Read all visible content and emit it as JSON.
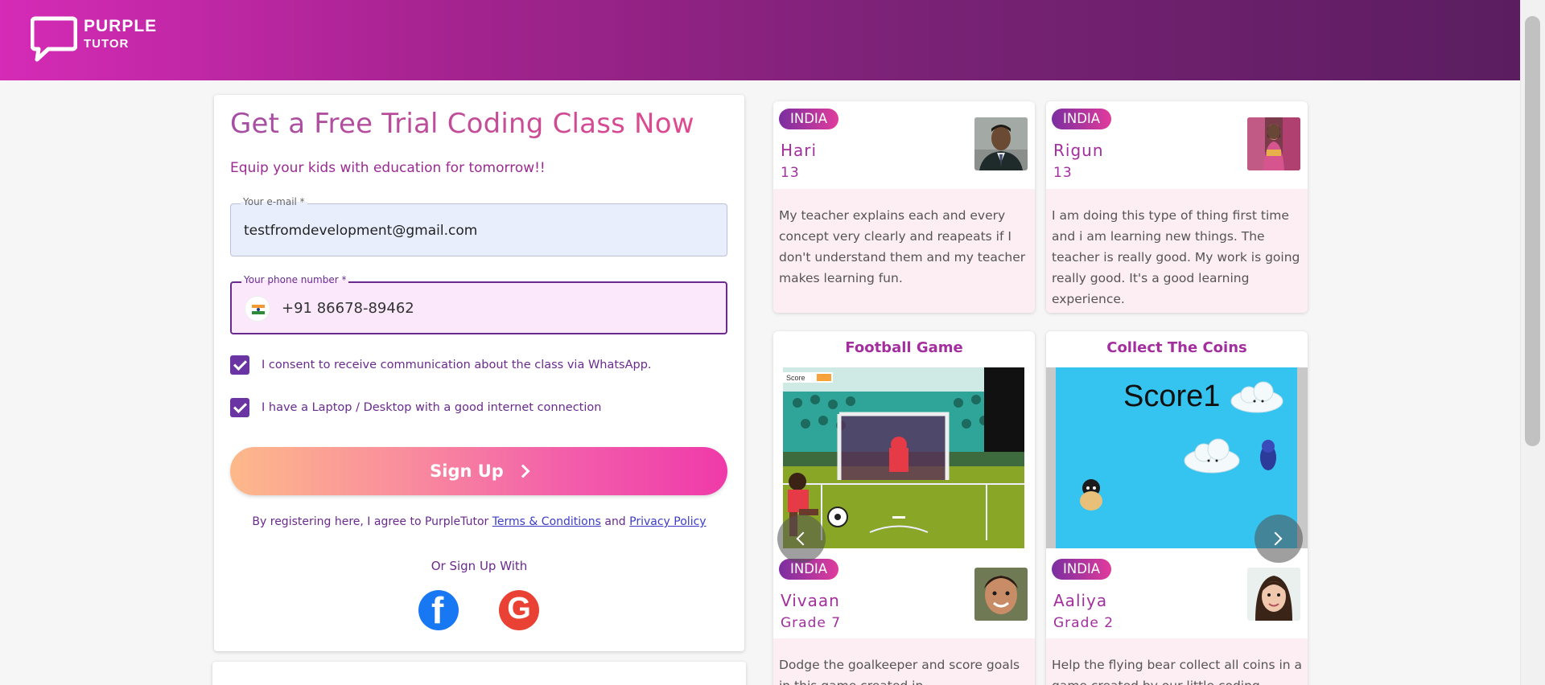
{
  "header": {
    "brand_line1": "PURPLE",
    "brand_line2": "TUTOR",
    "gradient": [
      "#d52bb6",
      "#5b1d60"
    ]
  },
  "form": {
    "title": "Get a Free Trial Coding Class Now",
    "subtitle": "Equip your kids with education for tomorrow!!",
    "email_label": "Your e-mail *",
    "email_value": "testfromdevelopment@gmail.com",
    "phone_label": "Your phone number *",
    "phone_value": "+91 86678-89462",
    "consent_whatsapp": "I consent to receive communication about the class via WhatsApp.",
    "consent_laptop": "I have a Laptop / Desktop with a good internet connection",
    "signup_label": "Sign Up",
    "terms_prefix": "By registering here, I agree to PurpleTutor",
    "terms_link": "Terms & Conditions",
    "terms_and": "and",
    "privacy_link": "Privacy Policy",
    "or_signup": "Or Sign Up With",
    "facebook_glyph": "f",
    "google_glyph": "G"
  },
  "testimonials": [
    {
      "country": "INDIA",
      "name": "Hari",
      "age": "13",
      "text": "My teacher explains each and every concept very clearly and reapeats if I don't understand them and my teacher makes learning fun."
    },
    {
      "country": "INDIA",
      "name": "Rigun",
      "age": "13",
      "text": "I am doing this type of thing first time and i am learning new things. The teacher is really good. My work is going really good. It's a good learning experience."
    }
  ],
  "games": [
    {
      "title": "Football Game",
      "country": "INDIA",
      "name": "Vivaan",
      "grade": "Grade 7",
      "text": "Dodge the goalkeeper and score goals in this game created in",
      "hud": "Score"
    },
    {
      "title": "Collect The Coins",
      "country": "INDIA",
      "name": "Aaliya",
      "grade": "Grade 2",
      "text": "Help the flying bear collect all coins in a game created by our little coding",
      "score_text": "Score1"
    }
  ],
  "icons": {
    "logo": "chat-bubble-icon",
    "prev": "chevron-left-icon",
    "next": "chevron-right-icon"
  }
}
